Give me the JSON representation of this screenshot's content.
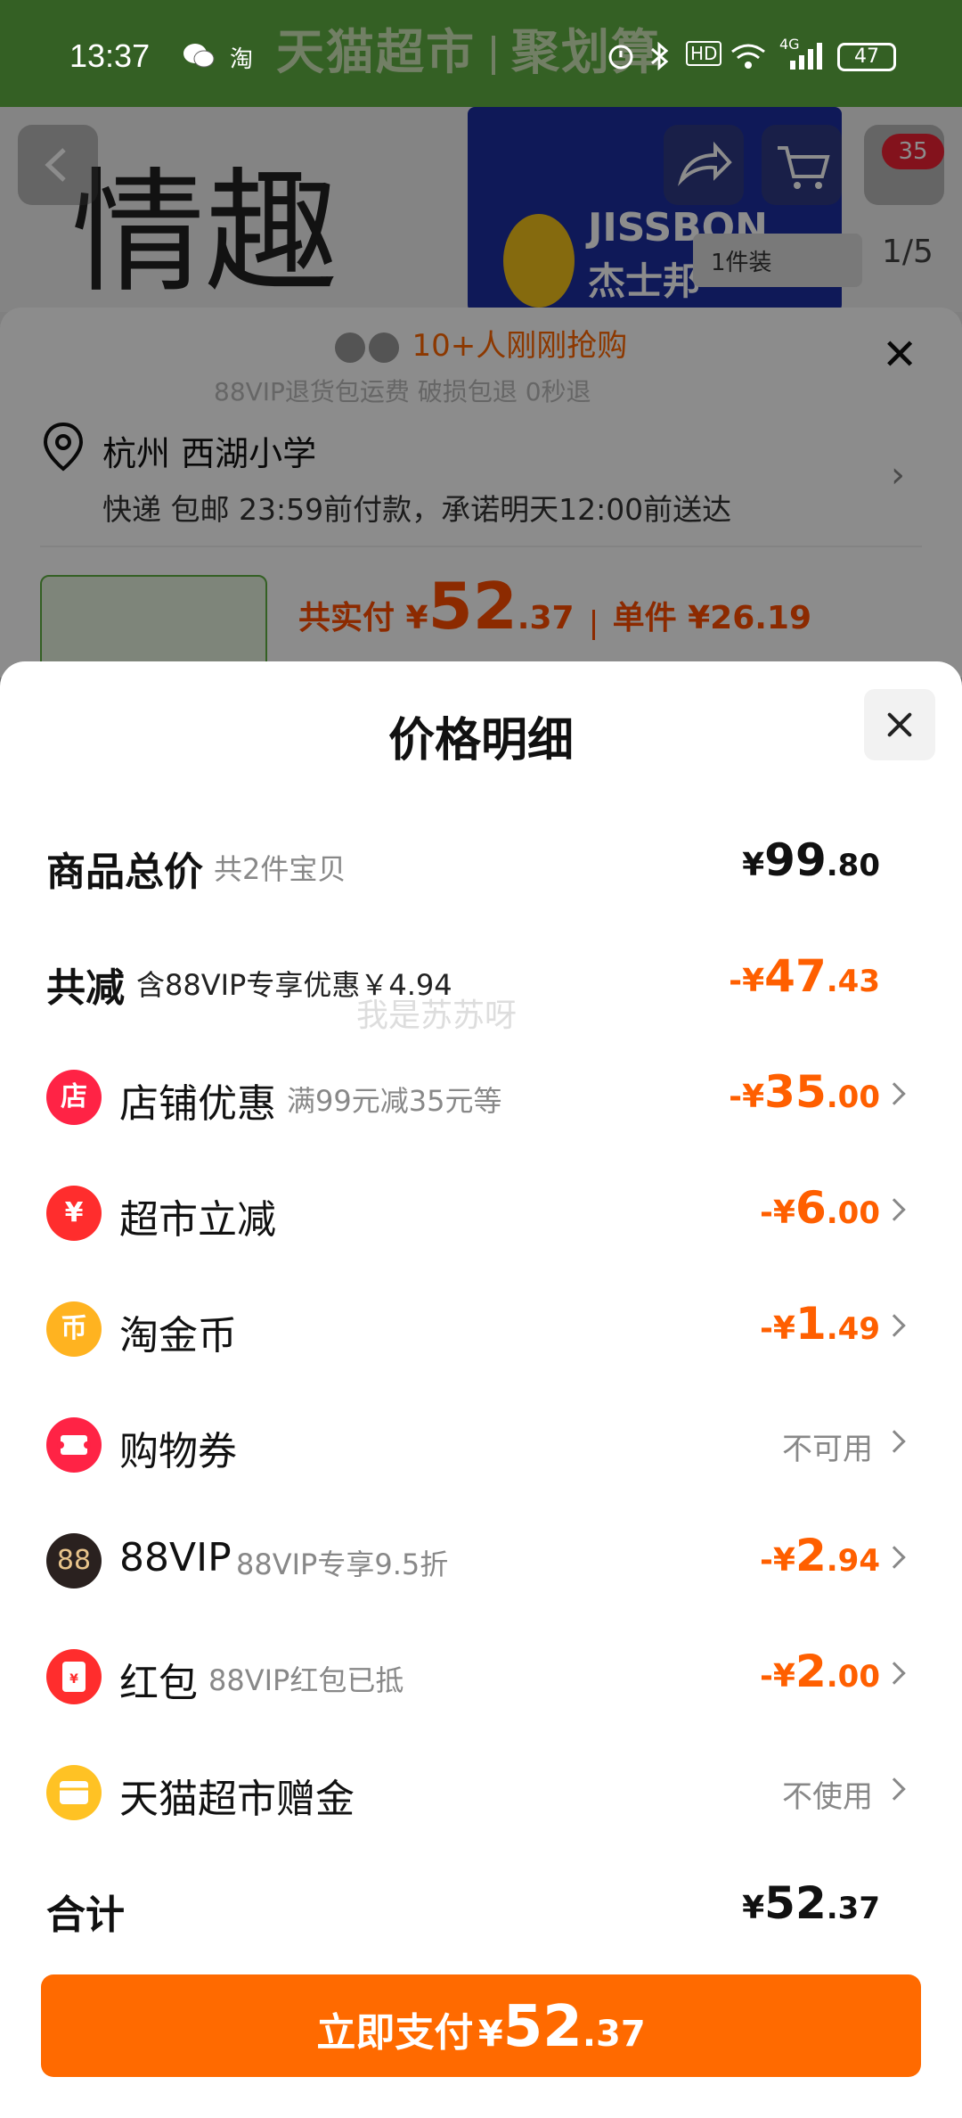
{
  "status_bar": {
    "time": "13:37",
    "network": "4G",
    "hd": "HD",
    "battery": "47"
  },
  "background": {
    "banner_left": "天猫超市",
    "banner_right": "聚划算",
    "hero_text": "情趣",
    "brand_en": "JISSBON",
    "brand_cn": "杰士邦",
    "pack": "1件装",
    "counter": "1/5",
    "cart_badge": "35",
    "buyers": "10+人刚刚抢购",
    "faded_line": "88VIP退货包运费 破损包退 0秒退",
    "address_title": "杭州 西湖小学",
    "address_sub": "快递 包邮 23:59前付款，承诺明天12:00前送达",
    "price_label": "共实付 ¥",
    "price_int": "52",
    "price_dec": ".37",
    "unit_label": "单件 ¥26.19"
  },
  "sheet": {
    "title": "价格明细",
    "watermark": "我是苏苏呀",
    "rows": [
      {
        "label": "商品总价",
        "sub": "共2件宝贝",
        "cur": "¥",
        "int": "99",
        "dec": ".80"
      },
      {
        "label": "共减",
        "sub": "含88VIP专享优惠￥4.94",
        "cur": "-¥",
        "int": "47",
        "dec": ".43"
      },
      {
        "label": "店铺优惠",
        "sub": "满99元减35元等",
        "cur": "-¥",
        "int": "35",
        "dec": ".00",
        "icon": "店"
      },
      {
        "label": "超市立减",
        "sub": "",
        "cur": "-¥",
        "int": "6",
        "dec": ".00",
        "icon": "¥"
      },
      {
        "label": "淘金币",
        "sub": "",
        "cur": "-¥",
        "int": "1",
        "dec": ".49",
        "icon": "币"
      },
      {
        "label": "购物券",
        "sub": "",
        "status": "不可用"
      },
      {
        "label": "88VIP",
        "sub": "88VIP专享9.5折",
        "cur": "-¥",
        "int": "2",
        "dec": ".94",
        "icon": "88"
      },
      {
        "label": "红包",
        "sub": "88VIP红包已抵",
        "cur": "-¥",
        "int": "2",
        "dec": ".00",
        "icon": "¥"
      },
      {
        "label": "天猫超市赠金",
        "sub": "",
        "status": "不使用"
      },
      {
        "label": "合计",
        "sub": "",
        "cur": "¥",
        "int": "52",
        "dec": ".37"
      }
    ],
    "pay_button": {
      "label": "立即支付",
      "cur": "¥",
      "int": "52",
      "dec": ".37"
    }
  },
  "colors": {
    "accent": "#ff6a00",
    "discount": "#ff5f00",
    "brand_green": "#5fb043"
  }
}
